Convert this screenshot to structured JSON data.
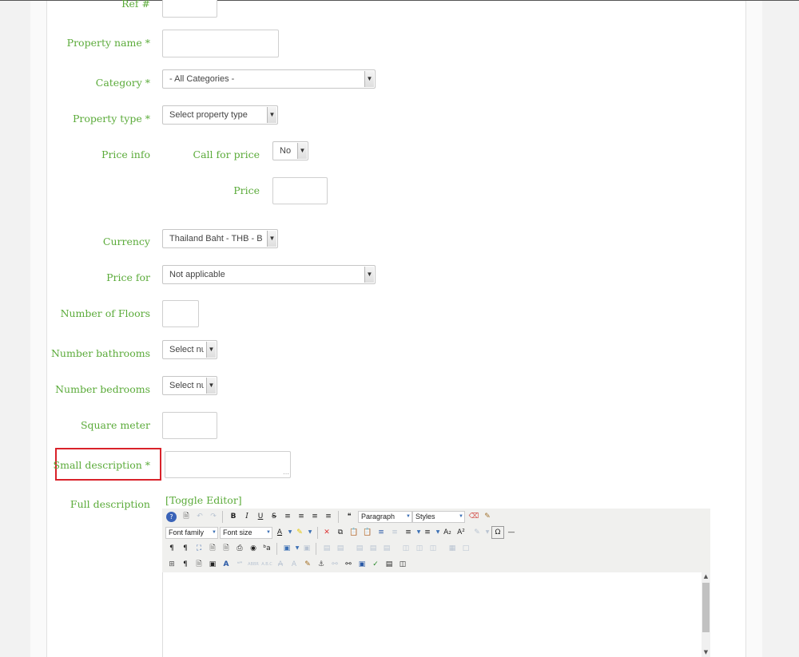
{
  "form": {
    "ref_label": "Ref #",
    "property_name_label": "Property name *",
    "category_label": "Category *",
    "category_value": "- All Categories -",
    "property_type_label": "Property type *",
    "property_type_value": "Select property type",
    "price_info_label": "Price info",
    "call_for_price_label": "Call for price",
    "call_for_price_value": "No",
    "price_label": "Price",
    "currency_label": "Currency",
    "currency_value": "Thailand Baht - THB - B",
    "price_for_label": "Price for",
    "price_for_value": "Not applicable",
    "floors_label": "Number of Floors",
    "bathrooms_label": "Number bathrooms",
    "bathrooms_value": "Select number",
    "bedrooms_label": "Number bedrooms",
    "bedrooms_value": "Select number",
    "square_meter_label": "Square meter",
    "small_description_label": "Small description *",
    "full_description_label": "Full description",
    "toggle_editor": "[Toggle Editor]"
  },
  "editor_toolbar": {
    "format_select": "Paragraph",
    "styles_select": "Styles",
    "font_family_select": "Font family",
    "font_size_select": "Font size"
  },
  "colors": {
    "label_green": "#5bab3a",
    "highlight_red": "#d9222a"
  }
}
